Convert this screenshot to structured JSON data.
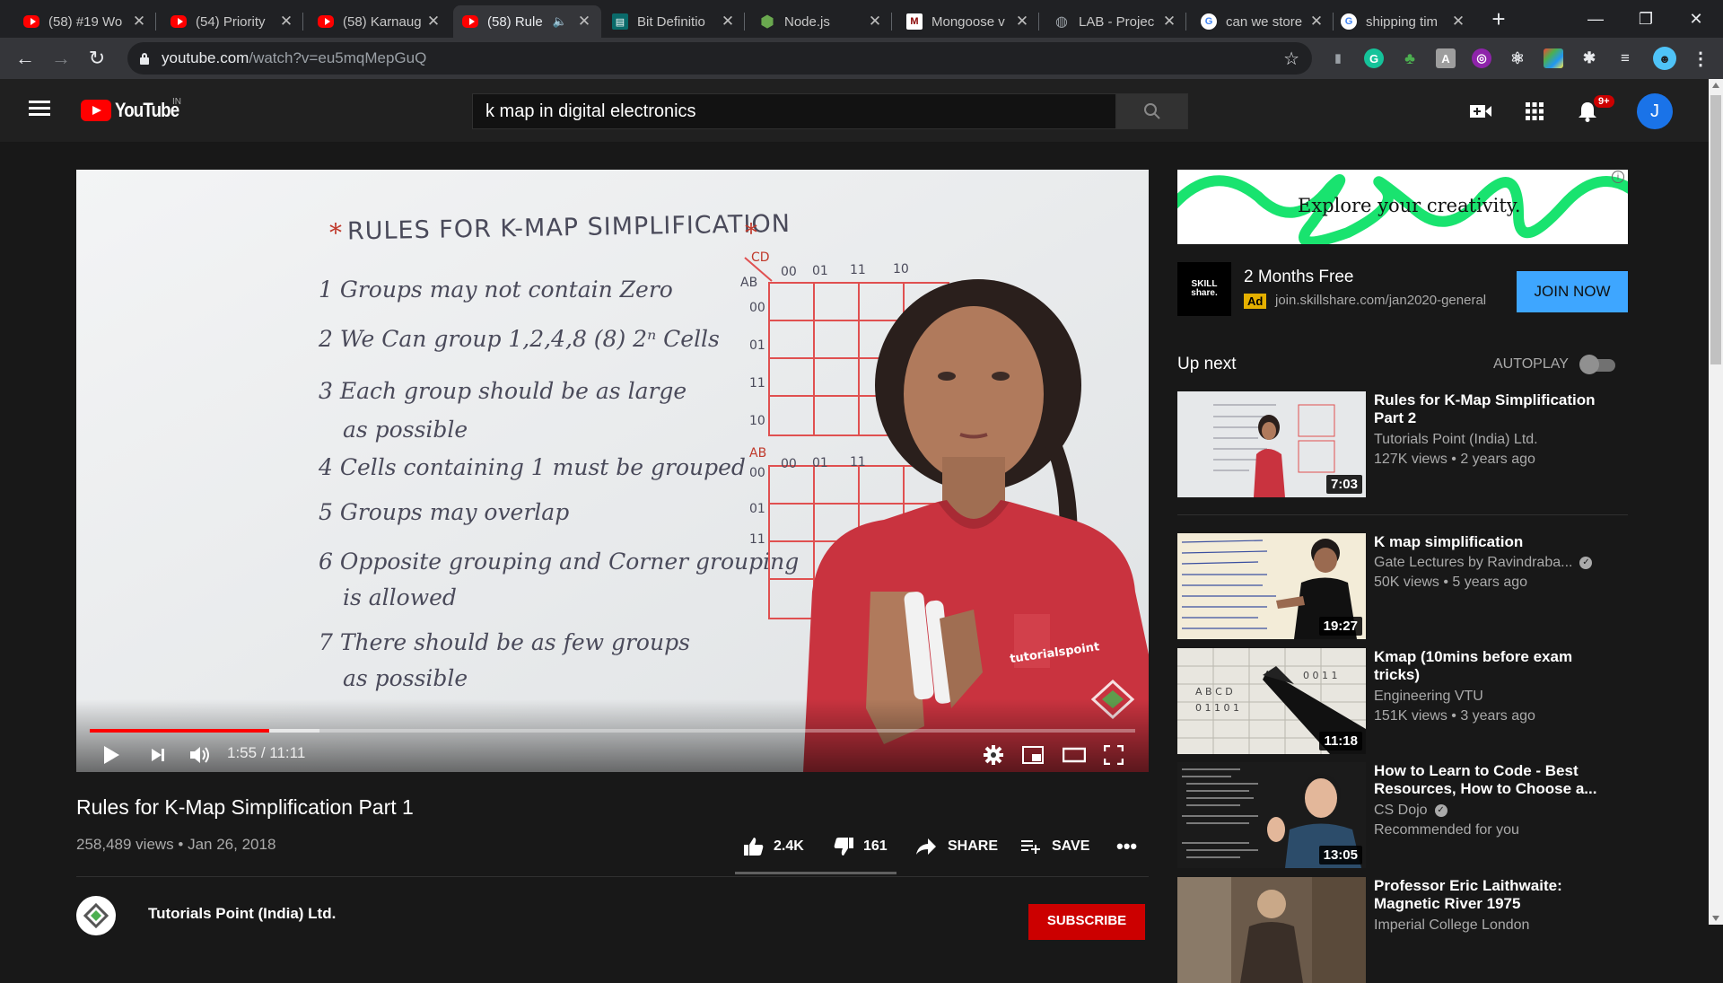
{
  "browser": {
    "tabs": [
      {
        "title": "(58) #19 Wo",
        "icon": "youtube-icon"
      },
      {
        "title": "(54) Priority",
        "icon": "youtube-icon"
      },
      {
        "title": "(58) Karnaug",
        "icon": "youtube-icon"
      },
      {
        "title": "(58) Rule",
        "icon": "youtube-icon"
      },
      {
        "title": "Bit Definitio",
        "icon": "book-icon"
      },
      {
        "title": "Node.js",
        "icon": "nodejs-icon"
      },
      {
        "title": "Mongoose v",
        "icon": "mongoose-icon"
      },
      {
        "title": "LAB - Projec",
        "icon": "globe-icon"
      },
      {
        "title": "can we store",
        "icon": "google-icon"
      },
      {
        "title": "shipping tim",
        "icon": "google-icon"
      }
    ],
    "url_host": "youtube.com",
    "url_path": "/watch?v=eu5mqMepGuQ"
  },
  "header": {
    "logo_text": "YouTube",
    "country_code": "IN",
    "search_value": "k map in digital electronics",
    "notification_count": "9+",
    "avatar_letter": "J"
  },
  "video": {
    "whiteboard": {
      "title": "RULES FOR K-MAP SIMPLIFICATION",
      "rules": [
        "1 Groups may not contain Zero",
        "2 We Can group 1,2,4,8 (8) 2ⁿ Cells",
        "3 Each group should be as large",
        "as possible",
        "4 Cells containing 1 must be grouped",
        "5 Groups may overlap",
        "6 Opposite grouping and Corner grouping",
        "is allowed",
        "7 There should be as few groups",
        "as possible"
      ],
      "kmap_col_labels": [
        "00",
        "01",
        "11",
        "10"
      ],
      "kmap_row_labels": [
        "00",
        "01",
        "11",
        "10"
      ],
      "kmap_corner": "AB",
      "kmap_corner2": "CD",
      "watermark": "tutorialspoint"
    },
    "time_current": "1:55",
    "time_total": "11:11",
    "progress_played_fraction": 0.172,
    "title": "Rules for K-Map Simplification Part 1",
    "views": "258,489 views",
    "date": "Jan 26, 2018",
    "likes": "2.4K",
    "dislikes": "161",
    "share_label": "SHARE",
    "save_label": "SAVE",
    "channel_name": "Tutorials Point (India) Ltd.",
    "subscribe_label": "SUBSCRIBE"
  },
  "ad": {
    "banner_text": "Explore your creativity.",
    "logo_text": "SKILL share.",
    "title": "2 Months Free",
    "tag": "Ad",
    "url": "join.skillshare.com/jan2020-general",
    "button": "JOIN NOW"
  },
  "upnext": {
    "label": "Up next",
    "autoplay_label": "AUTOPLAY",
    "autoplay_on": false
  },
  "recommendations": [
    {
      "title": "Rules for K-Map Simplification Part 2",
      "channel": "Tutorials Point (India) Ltd.",
      "meta": "127K views • 2 years ago",
      "duration": "7:03",
      "verified": false
    },
    {
      "title": "K map simplification",
      "channel": "Gate Lectures by Ravindraba...",
      "meta": "50K views • 5 years ago",
      "duration": "19:27",
      "verified": true
    },
    {
      "title": "Kmap (10mins before exam tricks)",
      "channel": "Engineering VTU",
      "meta": "151K views • 3 years ago",
      "duration": "11:18",
      "verified": false
    },
    {
      "title": "How to Learn to Code - Best Resources, How to Choose a...",
      "channel": "CS Dojo",
      "meta": "Recommended for you",
      "duration": "13:05",
      "verified": true
    },
    {
      "title": "Professor Eric Laithwaite: Magnetic River 1975",
      "channel": "Imperial College London",
      "meta": "",
      "duration": "",
      "verified": false
    }
  ],
  "colors": {
    "accent_red": "#ff0000",
    "join_blue": "#3ea6ff",
    "subscribe_red": "#cc0000"
  }
}
